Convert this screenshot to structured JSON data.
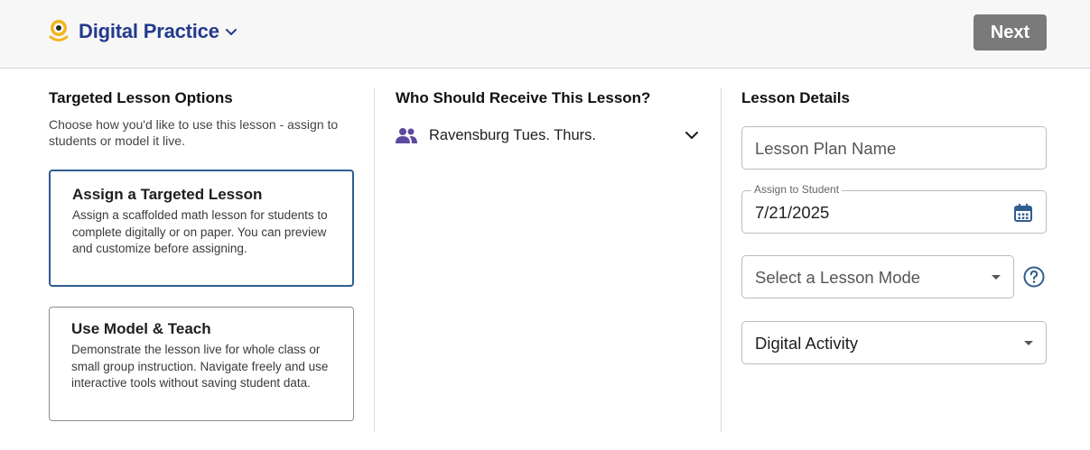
{
  "header": {
    "app_title": "Digital Practice",
    "logo_icon": "sun-logo-icon",
    "chevron_icon": "chevron-down-icon",
    "next_label": "Next",
    "brand_color": "#243a8c",
    "next_button_color": "#7a7a7a"
  },
  "options_column": {
    "title": "Targeted Lesson Options",
    "subtitle": "Choose how you'd like to use this lesson - assign to students or model it live.",
    "options": [
      {
        "title": "Assign a Targeted Lesson",
        "description": "Assign a scaffolded math lesson for students to complete digitally or on paper. You can preview and customize before assigning.",
        "selected": true
      },
      {
        "title": "Use Model & Teach",
        "description": "Demonstrate the lesson live for whole class or small group instruction. Navigate freely and use interactive tools without saving student data.",
        "selected": false
      }
    ],
    "selected_border_color": "#2f5d8f"
  },
  "recipients_column": {
    "title": "Who Should Receive This Lesson?",
    "class_name": "Ravensburg Tues. Thurs.",
    "icon": "people-icon",
    "icon_color": "#5b4a9e"
  },
  "details_column": {
    "title": "Lesson Details",
    "lesson_plan_name_placeholder": "Lesson Plan Name",
    "assign_date_label": "Assign to Student",
    "assign_date_value": "7/21/2025",
    "lesson_mode_placeholder": "Select a Lesson Mode",
    "activity_value": "Digital Activity",
    "icon_color": "#2f5d8f"
  }
}
